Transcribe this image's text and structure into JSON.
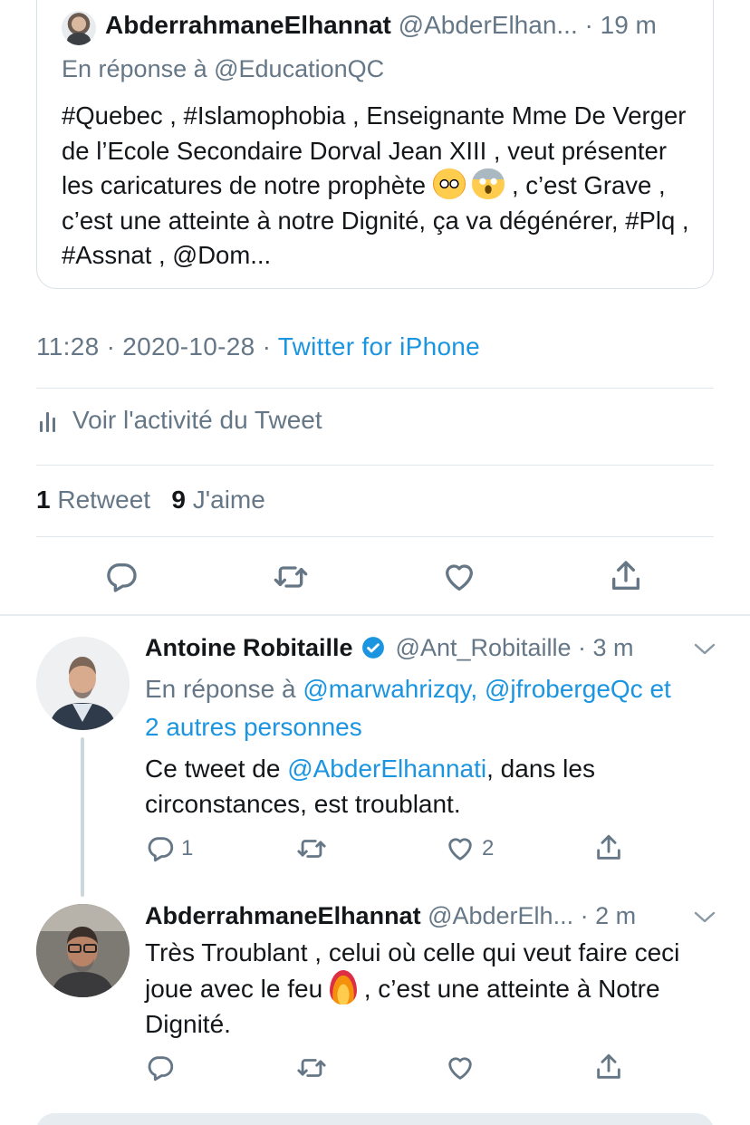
{
  "quoted_tweet": {
    "display_name": "AbderrahmaneElhannat",
    "handle_time": "@AbderElhan... · 19 m",
    "reply_to": "En réponse à @EducationQC",
    "text_1": "#Quebec , #Islamophobia , Enseignante Mme De Verger de l’Ecole Secondaire Dorval Jean XIII , veut présenter les caricatures de notre prophète",
    "text_2": " , c’est Grave , c’est une atteinte à notre Dignité, ça va dégénérer, #Plq , #Assnat , @Dom..."
  },
  "meta": {
    "time_date": "11:28 · 2020-10-28 · ",
    "source": "Twitter for iPhone"
  },
  "activity": {
    "label": "Voir l'activité du Tweet"
  },
  "counts": {
    "retweets": "1",
    "retweets_label": "Retweet",
    "likes": "9",
    "likes_label": "J'aime"
  },
  "icons": {
    "reply": "reply-icon",
    "retweet": "retweet-icon",
    "like": "heart-icon",
    "share": "share-icon",
    "verified": "verified-badge-icon",
    "chevron": "chevron-down-icon",
    "activity": "activity-chart-icon"
  },
  "colors": {
    "accent": "#1b95e0",
    "muted": "#657786",
    "divider": "#e1e8ed"
  },
  "replies": [
    {
      "display_name": "Antoine Robitaille",
      "handle_time": "@Ant_Robitaille · 3 m",
      "reply_prefix": "En réponse à ",
      "reply_mentions_1": "@marwahrizqy, @jfrobergeQc et",
      "reply_mentions_2": "2 autres personnes",
      "text_before": "Ce tweet de ",
      "text_mention": "@AbderElhannati",
      "text_after": ", dans les circonstances, est troublant.",
      "reply_count": "1",
      "like_count": "2"
    },
    {
      "display_name": "AbderrahmaneElhannat",
      "handle_time": "@AbderElh... · 2 m",
      "text_1": "Très Troublant , celui où celle qui veut faire ceci joue avec le feu ",
      "text_2": ", c’est une atteinte à Notre Dignité."
    }
  ]
}
